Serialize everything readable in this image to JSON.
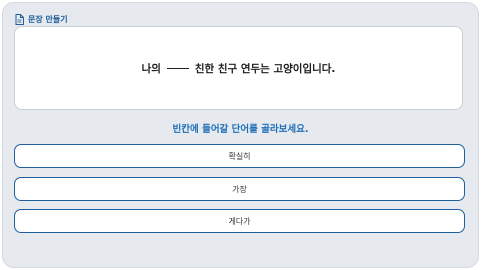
{
  "header": {
    "title": "문장 만들기",
    "icon": "document-icon"
  },
  "sentence": {
    "before": "나의",
    "after": "친한 친구 연두는 고양이입니다."
  },
  "instruction": "빈칸에 들어갈 단어를 골라보세요.",
  "options": [
    {
      "label": "확실히"
    },
    {
      "label": "가장"
    },
    {
      "label": "게다가"
    }
  ],
  "colors": {
    "accent": "#1f5f9e",
    "instruction": "#1f6fb8",
    "background": "#e6e9ed"
  }
}
